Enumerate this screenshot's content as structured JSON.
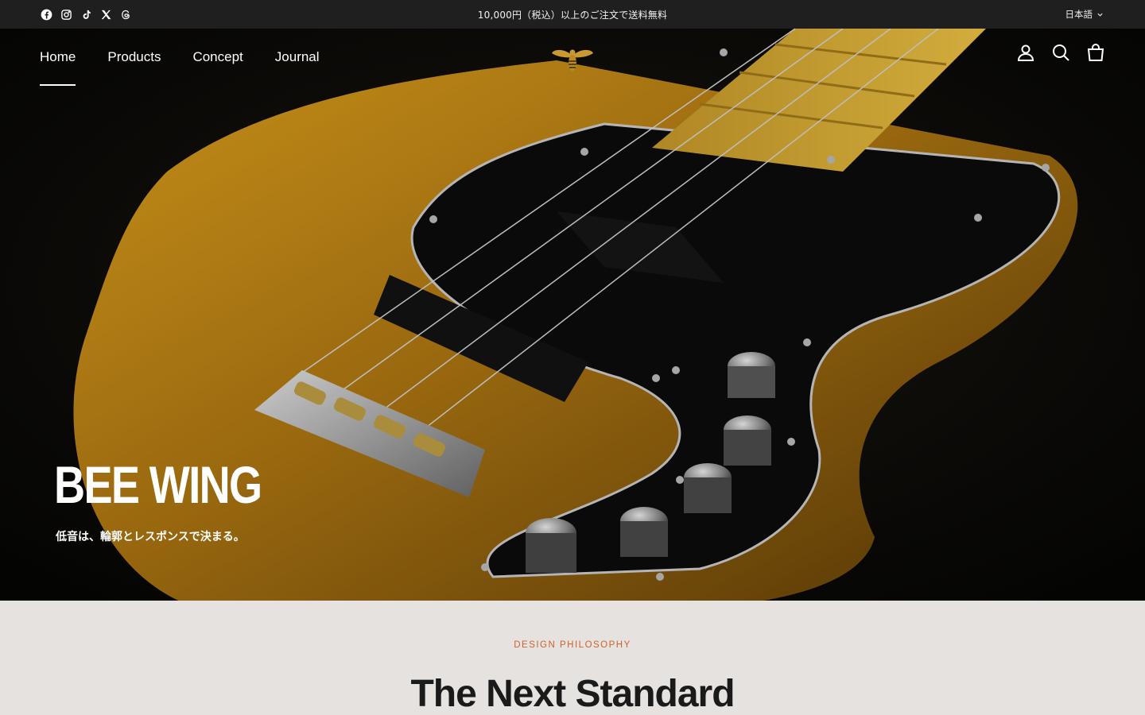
{
  "announcement": {
    "text": "10,000円（税込）以上のご注文で送料無料",
    "language": "日本語",
    "social": [
      "facebook-icon",
      "instagram-icon",
      "tiktok-icon",
      "x-icon",
      "threads-icon"
    ]
  },
  "nav": {
    "items": [
      {
        "label": "Home",
        "active": true
      },
      {
        "label": "Products",
        "active": false
      },
      {
        "label": "Concept",
        "active": false
      },
      {
        "label": "Journal",
        "active": false
      }
    ],
    "logo": "bee-logo",
    "actions": [
      "account-icon",
      "search-icon",
      "cart-icon"
    ]
  },
  "hero": {
    "title": "BEE WING",
    "subtitle": "低音は、輪郭とレスポンスで決まる。"
  },
  "section": {
    "eyebrow": "DESIGN PHILOSOPHY",
    "heading": "The Next Standard"
  },
  "colors": {
    "announce_bg": "#1f1f1f",
    "accent": "#d0612a",
    "section_bg": "#e5e2df",
    "body_gold": "#b98416"
  }
}
